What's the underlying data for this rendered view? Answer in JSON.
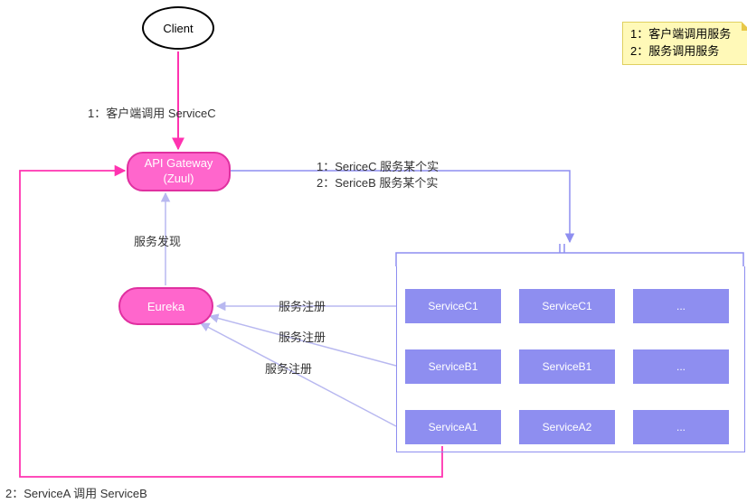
{
  "nodes": {
    "client": "Client",
    "gateway_l1": "API Gateway",
    "gateway_l2": "(Zuul)",
    "eureka": "Eureka"
  },
  "services": {
    "row1": {
      "a": "ServiceC1",
      "b": "ServiceC1",
      "c": "..."
    },
    "row2": {
      "a": "ServiceB1",
      "b": "ServiceB1",
      "c": "..."
    },
    "row3": {
      "a": "ServiceA1",
      "b": "ServiceA2",
      "c": "..."
    }
  },
  "labels": {
    "client_call": "1：客户端调用 ServiceC",
    "discovery": "服务发现",
    "reg1": "服务注册",
    "reg2": "服务注册",
    "reg3": "服务注册",
    "to_services_l1": "1：SericeC 服务某个实",
    "to_services_l2": "2：SericeB 服务某个实",
    "a_call_b": "2：ServiceA 调用 ServiceB"
  },
  "legend": {
    "l1": "1：客户端调用服务",
    "l2": "2：服务调用服务"
  },
  "colors": {
    "pink": "#FF66CC",
    "pink_stroke": "#FF33B0",
    "violet": "#8E8EF0",
    "violet_light": "#B0B0F0"
  }
}
